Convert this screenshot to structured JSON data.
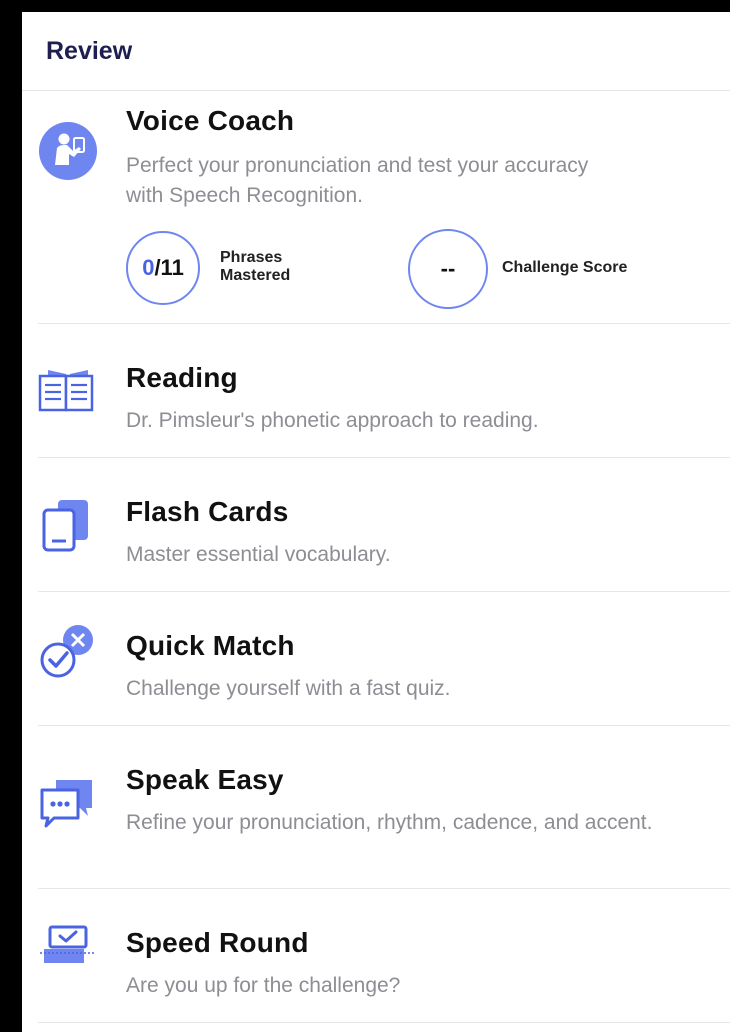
{
  "header": {
    "title": "Review"
  },
  "voice_coach": {
    "title": "Voice Coach",
    "description": "Perfect your pronunciation and test your accuracy with Speech Recognition.",
    "phrases_current": "0",
    "phrases_total": "/11",
    "phrases_label_line1": "Phrases",
    "phrases_label_line2": "Mastered",
    "challenge_value": "--",
    "challenge_label": "Challenge Score",
    "icon": "teacher-icon"
  },
  "items": [
    {
      "title": "Reading",
      "description": "Dr. Pimsleur's phonetic approach to reading.",
      "icon": "book-icon"
    },
    {
      "title": "Flash Cards",
      "description": "Master essential vocabulary.",
      "icon": "cards-icon"
    },
    {
      "title": "Quick Match",
      "description": "Challenge yourself with a fast quiz.",
      "icon": "match-icon"
    },
    {
      "title": "Speak Easy",
      "description": "Refine your pronunciation, rhythm, cadence, and accent.",
      "icon": "chat-bubbles-icon"
    },
    {
      "title": "Speed Round",
      "description": "Are you up for the challenge?",
      "icon": "speed-round-icon"
    }
  ],
  "colors": {
    "accent": "#6f86f0",
    "accent_dark": "#4a63e3",
    "title_dark": "#1d1f4f",
    "muted": "#8d8d93"
  }
}
